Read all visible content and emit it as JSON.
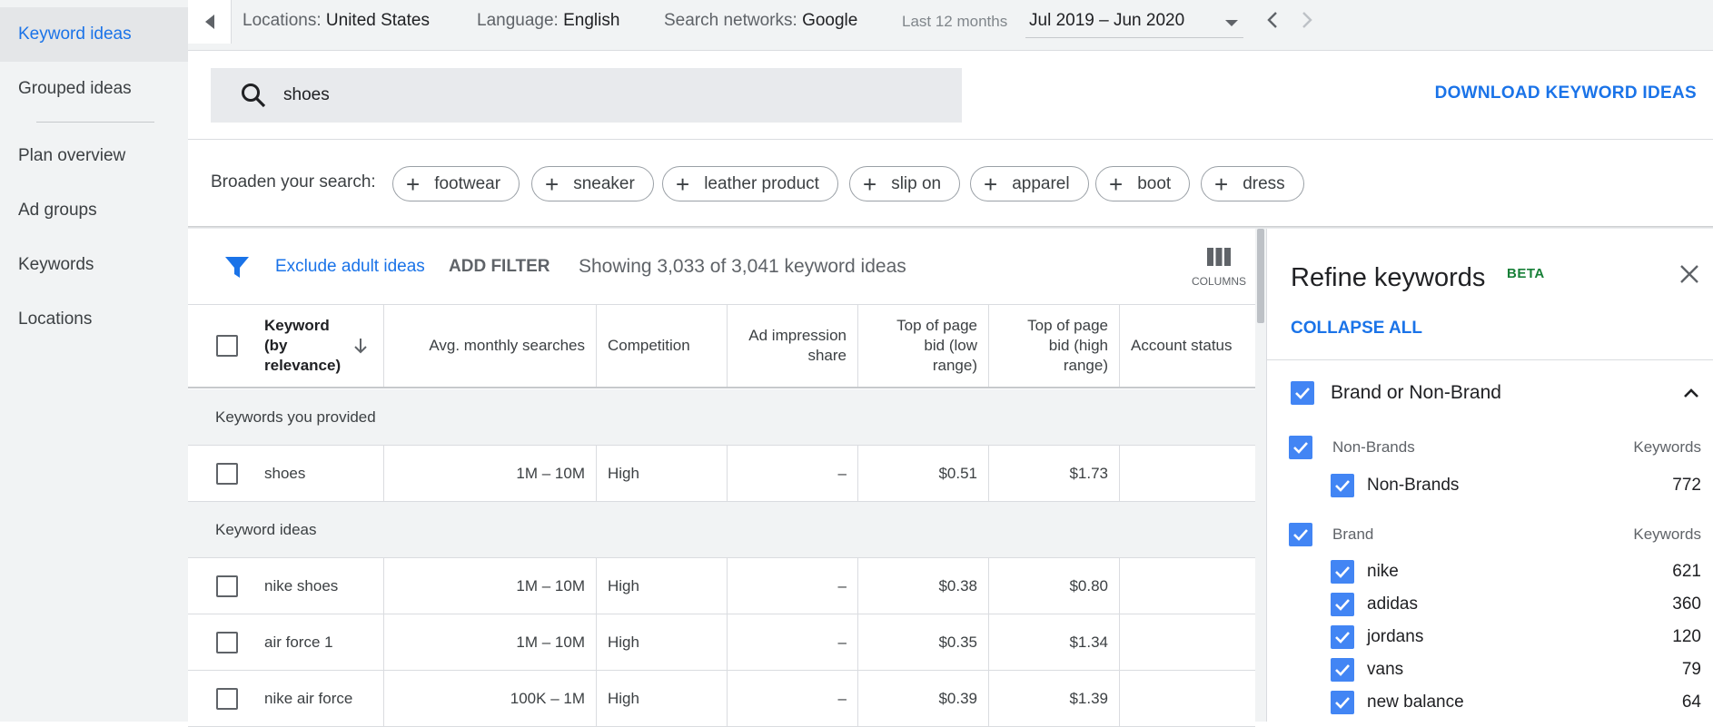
{
  "sidebar": {
    "items": [
      {
        "label": "Keyword ideas",
        "active": true
      },
      {
        "label": "Grouped ideas"
      },
      {
        "label": "Plan overview"
      },
      {
        "label": "Ad groups"
      },
      {
        "label": "Keywords"
      },
      {
        "label": "Locations"
      }
    ]
  },
  "topbar": {
    "locations_label": "Locations:",
    "locations_value": "United States",
    "language_label": "Language:",
    "language_value": "English",
    "networks_label": "Search networks:",
    "networks_value": "Google",
    "date_label": "Last 12 months",
    "date_value": "Jul 2019 – Jun 2020"
  },
  "search": {
    "query": "shoes",
    "download_label": "DOWNLOAD KEYWORD IDEAS"
  },
  "broaden": {
    "label": "Broaden your search:",
    "chips": [
      "footwear",
      "sneaker",
      "leather product",
      "slip on",
      "apparel",
      "boot",
      "dress"
    ]
  },
  "filterbar": {
    "exclude_label": "Exclude adult ideas",
    "add_filter_label": "ADD FILTER",
    "showing_text": "Showing 3,033 of 3,041 keyword ideas",
    "columns_label": "COLUMNS"
  },
  "table": {
    "headers": {
      "keyword": "Keyword (by relevance)",
      "searches": "Avg. monthly searches",
      "competition": "Competition",
      "impression": "Ad impression share",
      "low_bid": "Top of page bid (low range)",
      "high_bid": "Top of page bid (high range)",
      "status": "Account status"
    },
    "provided_group": "Keywords you provided",
    "provided_rows": [
      {
        "keyword": "shoes",
        "searches": "1M – 10M",
        "competition": "High",
        "impression": "–",
        "low_bid": "$0.51",
        "high_bid": "$1.73"
      }
    ],
    "ideas_group": "Keyword ideas",
    "idea_rows": [
      {
        "keyword": "nike shoes",
        "searches": "1M – 10M",
        "competition": "High",
        "impression": "–",
        "low_bid": "$0.38",
        "high_bid": "$0.80"
      },
      {
        "keyword": "air force 1",
        "searches": "1M – 10M",
        "competition": "High",
        "impression": "–",
        "low_bid": "$0.35",
        "high_bid": "$1.34"
      },
      {
        "keyword": "nike air force",
        "searches": "100K – 1M",
        "competition": "High",
        "impression": "–",
        "low_bid": "$0.39",
        "high_bid": "$1.39"
      }
    ]
  },
  "refine": {
    "title": "Refine keywords",
    "beta": "BETA",
    "collapse_all": "COLLAPSE ALL",
    "section_title": "Brand or Non-Brand",
    "nonbrands_group": "Non-Brands",
    "nonbrands_group_count": "Keywords",
    "nonbrands_item": "Non-Brands",
    "nonbrands_item_count": "772",
    "brand_group": "Brand",
    "brand_group_count": "Keywords",
    "brands": [
      {
        "name": "nike",
        "count": "621"
      },
      {
        "name": "adidas",
        "count": "360"
      },
      {
        "name": "jordans",
        "count": "120"
      },
      {
        "name": "vans",
        "count": "79"
      },
      {
        "name": "new balance",
        "count": "64"
      }
    ]
  },
  "colors": {
    "accent": "#1a73e8",
    "checkbox": "#4285f4",
    "beta": "#188038"
  }
}
